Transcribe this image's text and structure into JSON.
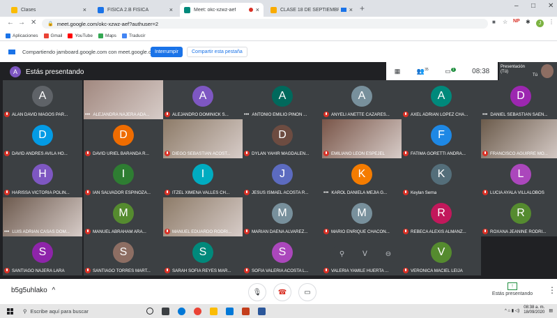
{
  "tabs": [
    {
      "title": "Clases",
      "color": "#fbbc04"
    },
    {
      "title": "FÍSICA 2.B FÍSICA",
      "color": "#1a73e8"
    },
    {
      "title": "Meet: okc-xzwz-aef",
      "color": "#00897b"
    },
    {
      "title": "CLASE 18 DE SEPTIEMBRE -",
      "color": "#f9ab00"
    }
  ],
  "new_tab": "+",
  "window_controls": {
    "minimize": "–",
    "maximize": "□",
    "close": "✕"
  },
  "address": {
    "url": "meet.google.com/okc-xzwz-aef?authuser=2",
    "back": "←",
    "forward": "→",
    "reload": "✕"
  },
  "bookmarks": [
    "Aplicaciones",
    "Gmail",
    "YouTube",
    "Maps",
    "Traducir"
  ],
  "share_bar": {
    "text": "Compartiendo jamboard.google.com con meet.google.com",
    "stop": "Interrumpir",
    "share_tab": "Compartir esta pestaña"
  },
  "meeting": {
    "presenting_text": "Estás presentando",
    "presenter_initial": "A",
    "participants_count": "35",
    "chat_badge": "1",
    "time": "08:38",
    "self_label": "Presentación\n(Tú)",
    "self_you": "Tú"
  },
  "participants": [
    {
      "name": "ALAN DAVID MAGOS PAR...",
      "initial": "A",
      "color": "#5f6368",
      "muted": true
    },
    {
      "name": "ALEJANDRA NAJERA ADA...",
      "initial": "",
      "color": "video",
      "muted": false
    },
    {
      "name": "ALEJANDRO DOMINICK S...",
      "initial": "A",
      "color": "#7e57c2",
      "muted": true
    },
    {
      "name": "ANTONIO EMILIO PIÑON ...",
      "initial": "A",
      "color": "#00695c",
      "muted": false
    },
    {
      "name": "ANYELI ANETTE CAZARES...",
      "initial": "A",
      "color": "#78909c",
      "muted": true
    },
    {
      "name": "AXEL ADRIAN LOPEZ CHA...",
      "initial": "A",
      "color": "#00897b",
      "muted": true
    },
    {
      "name": "DANIEL SEBASTIAN SAEN...",
      "initial": "D",
      "color": "#9c27b0",
      "muted": false
    },
    {
      "name": "DAVID ANDRES AVILA HO...",
      "initial": "D",
      "color": "#039be5",
      "muted": true
    },
    {
      "name": "DAVID URIEL BARANDA R...",
      "initial": "D",
      "color": "#ef6c00",
      "muted": true
    },
    {
      "name": "DIEGO SEBASTIAN ACOST...",
      "initial": "",
      "color": "video",
      "muted": true
    },
    {
      "name": "DYLAN YAHIR MAGDALEN...",
      "initial": "D",
      "color": "#6d4c41",
      "muted": true
    },
    {
      "name": "EMILIANO LEON ESPEJEL",
      "initial": "",
      "color": "video",
      "muted": true
    },
    {
      "name": "FATIMA GORETTI ANDRA...",
      "initial": "F",
      "color": "#1e88e5",
      "muted": true
    },
    {
      "name": "FRANCISCO AGUIRRE MO...",
      "initial": "",
      "color": "video",
      "muted": true
    },
    {
      "name": "HARISSA VICTORIA POLIN...",
      "initial": "H",
      "color": "#7e57c2",
      "muted": true
    },
    {
      "name": "IAN SALVADOR ESPINOZA...",
      "initial": "I",
      "color": "#2e7d32",
      "muted": true
    },
    {
      "name": "ITZEL XIMENA VALLES CH...",
      "initial": "I",
      "color": "#00acc1",
      "muted": true
    },
    {
      "name": "JESUS ISMAEL ACOSTA R...",
      "initial": "J",
      "color": "#5c6bc0",
      "muted": true
    },
    {
      "name": "KAROL DANIELA MEJIA G...",
      "initial": "K",
      "color": "#f57c00",
      "muted": false
    },
    {
      "name": "Keylan Serna",
      "initial": "K",
      "color": "#546e7a",
      "muted": true
    },
    {
      "name": "LUCIA AYALA VILLALOBOS",
      "initial": "L",
      "color": "#ab47bc",
      "muted": true
    },
    {
      "name": "LUIS ADRIAN CASAS DOM...",
      "initial": "",
      "color": "video",
      "muted": false
    },
    {
      "name": "MANUEL ABRAHAM ARA...",
      "initial": "M",
      "color": "#558b2f",
      "muted": true
    },
    {
      "name": "MANUEL EDUARDO RODRI...",
      "initial": "",
      "color": "video",
      "muted": true
    },
    {
      "name": "MARIAN DAENA ALVAREZ...",
      "initial": "M",
      "color": "#78909c",
      "muted": true
    },
    {
      "name": "MARIO ENRIQUE CHACON...",
      "initial": "M",
      "color": "#78909c",
      "muted": true
    },
    {
      "name": "REBECA ALEXIS ALMANZ...",
      "initial": "R",
      "color": "#c2185b",
      "muted": true
    },
    {
      "name": "ROXANA JEANINE RODRI...",
      "initial": "R",
      "color": "#558b2f",
      "muted": true
    },
    {
      "name": "SANTIAGO NAJERA LARA",
      "initial": "S",
      "color": "#8e24aa",
      "muted": true
    },
    {
      "name": "SANTIAGO TORRES MART...",
      "initial": "S",
      "color": "#8d6e63",
      "muted": true
    },
    {
      "name": "SARAH SOFIA REYES MAR...",
      "initial": "S",
      "color": "#00897b",
      "muted": true
    },
    {
      "name": "SOFIA VALERIA ACOSTA L...",
      "initial": "S",
      "color": "#ab47bc",
      "muted": true
    },
    {
      "name": "VALERIA YAMILE HUERTA ...",
      "initial": "",
      "color": "#3c4043",
      "muted": true
    },
    {
      "name": "VERONICA MACIEL LEIJA",
      "initial": "V",
      "color": "#558b2f",
      "muted": true
    }
  ],
  "controls": {
    "meeting_code": "b5g5uhlako",
    "code_chevron": "^",
    "presenting_label": "Estás presentando",
    "more": "⋮"
  },
  "taskbar": {
    "search_placeholder": "Escribe aquí para buscar",
    "time": "08:38 a. m.",
    "date": "18/09/2020"
  }
}
